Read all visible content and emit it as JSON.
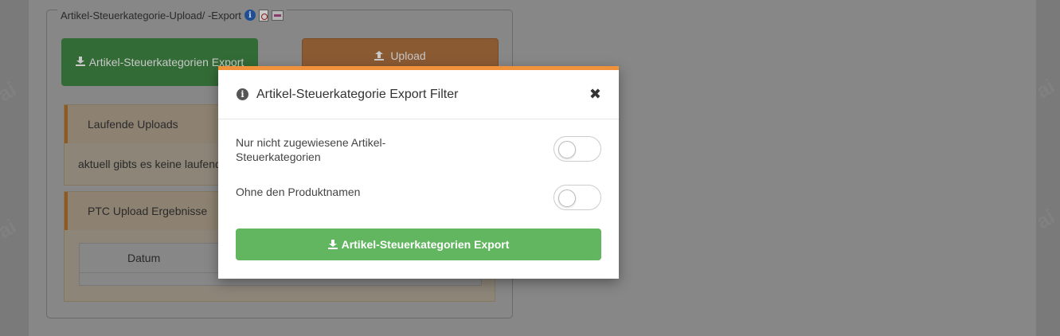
{
  "background": {
    "fieldset_legend": "Artikel-Steuerkategorie-Upload/ -Export",
    "export_button_label": "Artikel-Steuerkategorien Export",
    "upload_button_label": "Upload",
    "running_uploads": {
      "heading": "Laufende Uploads",
      "message": "aktuell gibts es keine laufenden"
    },
    "results": {
      "heading": "PTC Upload Ergebnisse",
      "table_columns": [
        "Datum"
      ]
    },
    "watermark_fragment": "ai"
  },
  "modal": {
    "title": "Artikel-Steuerkategorie Export Filter",
    "close_glyph": "✖",
    "filters": [
      {
        "label": "Nur nicht zugewiesene Artikel-Steuerkategorien",
        "enabled": false
      },
      {
        "label": "Ohne den Produktnamen",
        "enabled": false
      }
    ],
    "export_button_label": "Artikel-Steuerkategorien Export"
  },
  "colors": {
    "modal_accent": "#f0923b",
    "export_green": "#62b660",
    "upload_orange": "#f0923b"
  },
  "icons": {
    "info": "info-icon",
    "pdf": "pdf-icon",
    "document": "document-icon",
    "close": "close-icon",
    "download": "download-icon",
    "upload": "upload-icon"
  }
}
